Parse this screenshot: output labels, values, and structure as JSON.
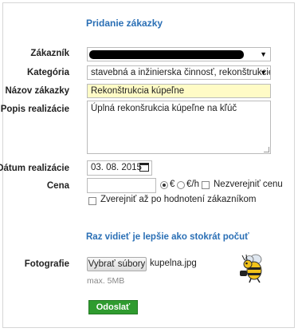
{
  "form": {
    "title": "Pridanie zákazky",
    "fields": {
      "customer": {
        "label": "Zákazník",
        "value": ""
      },
      "category": {
        "label": "Kategória",
        "value": "stavebná a inžinierska činnosť, rekonštrukcie"
      },
      "order_name": {
        "label": "Názov zákazky",
        "value": "Rekonštrukcia kúpeľne"
      },
      "description": {
        "label": "Popis realizácie",
        "value": "Úplná rekonšrukcia kúpeľne na kľúč"
      },
      "date": {
        "label": "Dátum realizácie",
        "value": "03. 08. 2015"
      },
      "price": {
        "label": "Cena",
        "value": "",
        "currency_euro": "€",
        "currency_per_hour": "€/h",
        "hide_price": "Nezverejniť cenu"
      },
      "publish_after_rating": "Zverejniť až po hodnotení zákazníkom"
    },
    "promo_link": "Raz vidieť je lepšie ako stokrát počuť",
    "photos": {
      "label": "Fotografie",
      "choose_button": "Vybrať súbory",
      "file_name": "kupelna.jpg",
      "max_size_hint": "max. 5MB"
    },
    "submit": "Odoslať"
  }
}
